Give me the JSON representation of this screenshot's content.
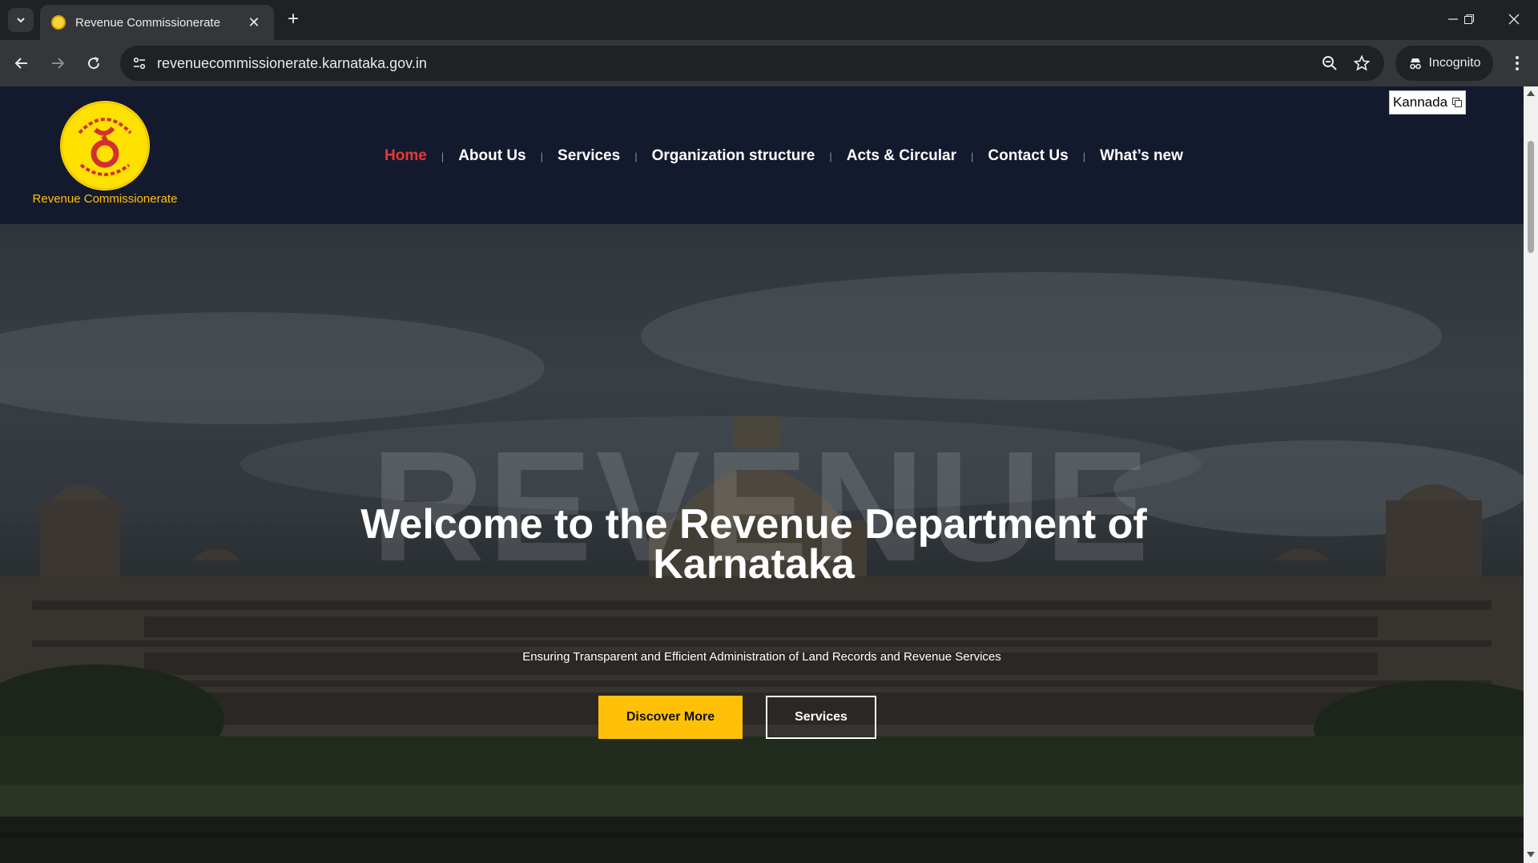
{
  "browser": {
    "tab_title": "Revenue Commissionerate",
    "url": "revenuecommissionerate.karnataka.gov.in",
    "incognito_label": "Incognito"
  },
  "site": {
    "logo_text": "Revenue Commissionerate",
    "language_button": "Kannada",
    "nav": [
      {
        "label": "Home",
        "active": true
      },
      {
        "label": "About Us"
      },
      {
        "label": "Services"
      },
      {
        "label": "Organization structure"
      },
      {
        "label": "Acts & Circular"
      },
      {
        "label": "Contact Us"
      },
      {
        "label": "What’s new"
      }
    ]
  },
  "hero": {
    "watermark": "REVENUE",
    "title": "Welcome to the Revenue Department of Karnataka",
    "subtitle": "Ensuring Transparent and Efficient Administration of Land Records and Revenue Services",
    "primary_button": "Discover More",
    "secondary_button": "Services"
  },
  "colors": {
    "header_bg": "#141a2e",
    "accent_yellow": "#ffc107",
    "active_nav": "#e53935"
  }
}
